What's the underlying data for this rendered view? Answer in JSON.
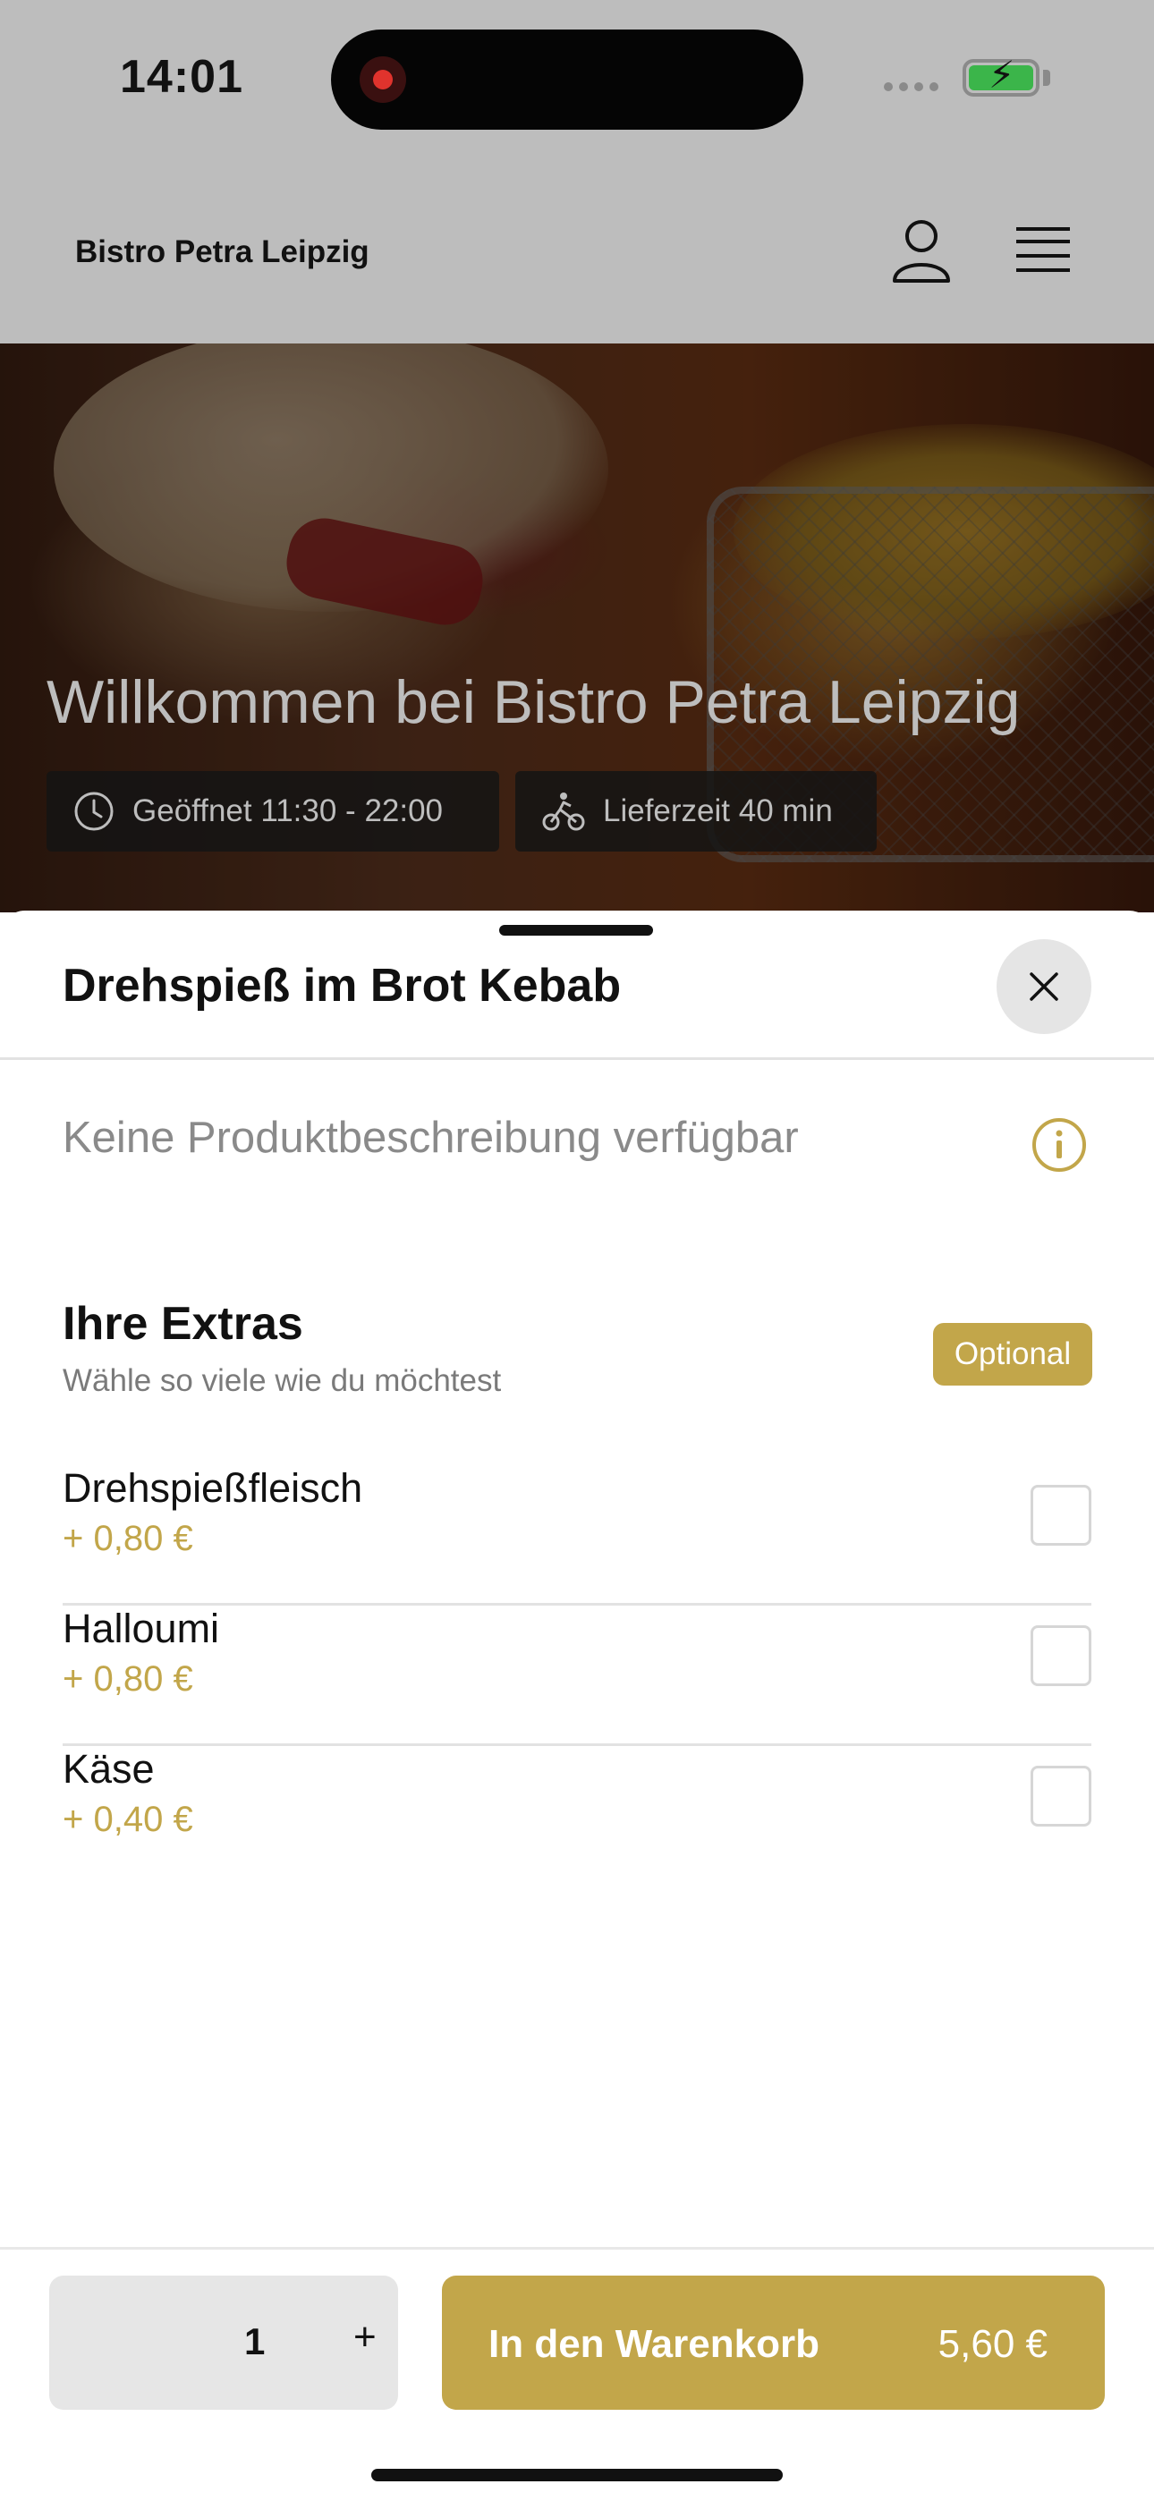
{
  "status_bar": {
    "time": "14:01",
    "battery_color": "#3bb54a"
  },
  "header": {
    "brand": "Bistro Petra Leipzig",
    "icons": [
      "user-icon",
      "hamburger-menu-icon"
    ]
  },
  "hero": {
    "title": "Willkommen bei Bistro Petra Leipzig",
    "opening_hours": "Geöffnet 11:30 - 22:00",
    "delivery_time": "Lieferzeit 40 min",
    "icons": [
      "clock-icon",
      "delivery-bike-icon"
    ]
  },
  "product_sheet": {
    "title": "Drehspieß im Brot Kebab",
    "description": "Keine Produktbeschreibung verfügbar",
    "extras": {
      "title": "Ihre Extras",
      "subtitle": "Wähle so viele wie du möchtest",
      "badge": "Optional",
      "options": [
        {
          "name": "Drehspießfleisch",
          "price": "+ 0,80 €",
          "checked": false
        },
        {
          "name": "Halloumi",
          "price": "+ 0,80 €",
          "checked": false
        },
        {
          "name": "Käse",
          "price": "+ 0,40 €",
          "checked": false
        }
      ]
    }
  },
  "footer": {
    "quantity": "1",
    "plus": "+",
    "add_to_cart": "In den Warenkorb",
    "total": "5,60 €"
  },
  "colors": {
    "accent": "#c2a64a",
    "overlay": "#bdbdbd"
  }
}
